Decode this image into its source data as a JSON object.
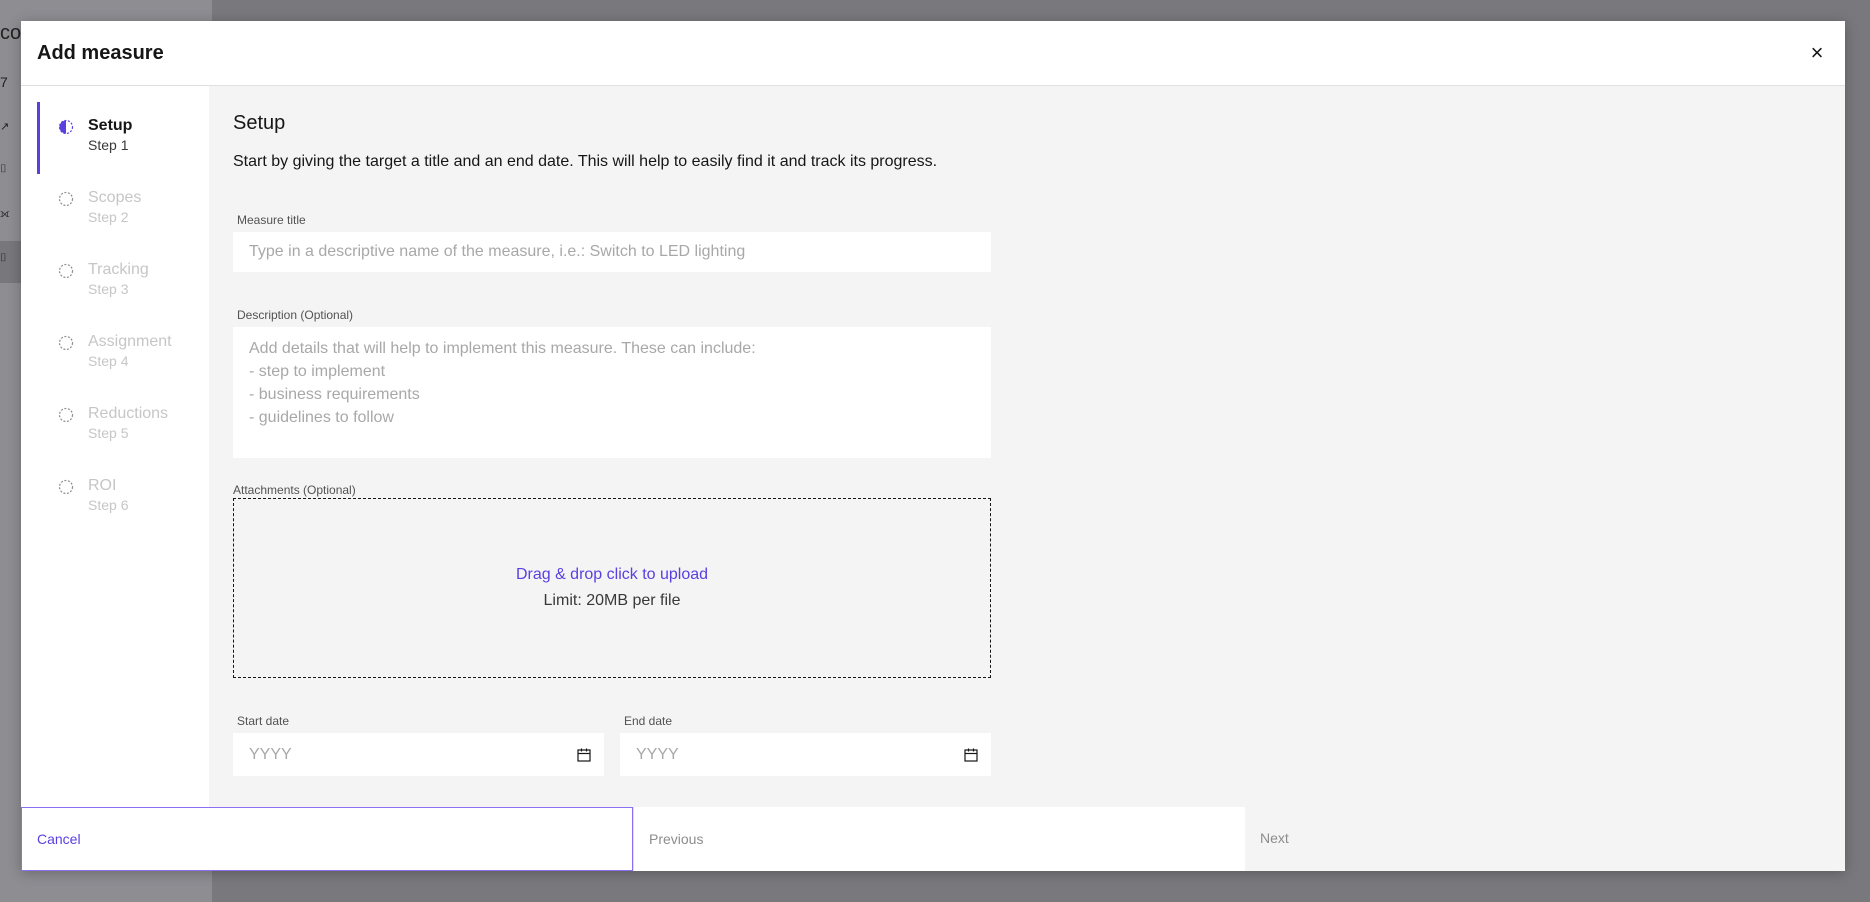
{
  "background": {
    "lines": [
      "co",
      "7",
      "↗",
      "⌷",
      "⟗",
      "⌷"
    ]
  },
  "modal": {
    "title": "Add measure",
    "close_label": "×"
  },
  "stepper": {
    "steps": [
      {
        "title": "Setup",
        "sub": "Step 1"
      },
      {
        "title": "Scopes",
        "sub": "Step 2"
      },
      {
        "title": "Tracking",
        "sub": "Step 3"
      },
      {
        "title": "Assignment",
        "sub": "Step 4"
      },
      {
        "title": "Reductions",
        "sub": "Step 5"
      },
      {
        "title": "ROI",
        "sub": "Step 6"
      }
    ]
  },
  "setup": {
    "title": "Setup",
    "description": "Start by giving the target a title and an end date. This will help to easily find it and track its progress.",
    "measure_title_label": "Measure title",
    "measure_title_placeholder": "Type in a descriptive name of the measure, i.e.: Switch to LED lighting",
    "description_label": "Description (Optional)",
    "description_placeholder": "Add details that will help to implement this measure. These can include:\n- step to implement\n- business requirements\n- guidelines to follow",
    "attachments_label": "Attachments (Optional)",
    "upload_link": "Drag & drop click to upload",
    "upload_limit": "Limit: 20MB per file",
    "start_date_label": "Start date",
    "start_date_placeholder": "YYYY",
    "end_date_label": "End date",
    "end_date_placeholder": "YYYY"
  },
  "footer": {
    "cancel": "Cancel",
    "previous": "Previous",
    "next": "Next"
  },
  "colors": {
    "accent": "#5b3fe0"
  }
}
